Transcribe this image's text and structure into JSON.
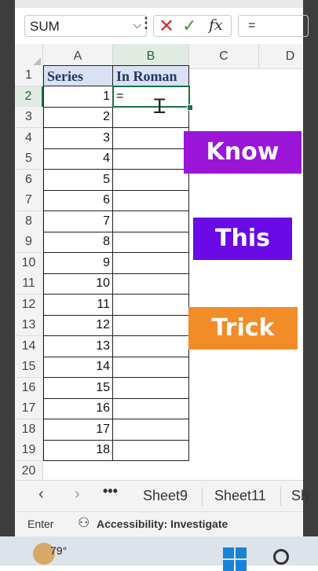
{
  "formula_bar": {
    "name_box": "SUM",
    "name_box_arrow": "⌵",
    "dots": "⋮",
    "cancel_glyph": "✕",
    "enter_glyph": "✓",
    "fx_label": "fx",
    "formula": "="
  },
  "grid": {
    "columns": [
      "A",
      "B",
      "C",
      "D"
    ],
    "rows": [
      "1",
      "2",
      "3",
      "4",
      "5",
      "6",
      "7",
      "8",
      "9",
      "10",
      "11",
      "12",
      "13",
      "14",
      "15",
      "16",
      "17",
      "18",
      "19",
      "20"
    ],
    "headers": [
      "Series",
      "In Roman"
    ],
    "series": [
      "1",
      "2",
      "3",
      "4",
      "5",
      "6",
      "7",
      "8",
      "9",
      "10",
      "11",
      "12",
      "13",
      "14",
      "15",
      "16",
      "17",
      "18"
    ],
    "active_cell_value": "=",
    "active_cell": "B2"
  },
  "overlays": [
    {
      "text": "Know",
      "color": "#9b15d9"
    },
    {
      "text": "This",
      "color": "#6a0ae6"
    },
    {
      "text": "Trick",
      "color": "#f28c28"
    }
  ],
  "sheet_tabs": {
    "prev": "‹",
    "next": "›",
    "more": "•••",
    "tabs": [
      "Sheet9",
      "Sheet11",
      "Sh"
    ]
  },
  "status_bar": {
    "mode": "Enter",
    "accessibility": "Accessibility: Investigate"
  },
  "taskbar": {
    "temperature": "79°"
  },
  "colors": {
    "accent": "#1e7145",
    "header_fill": "#d9e1f2"
  }
}
